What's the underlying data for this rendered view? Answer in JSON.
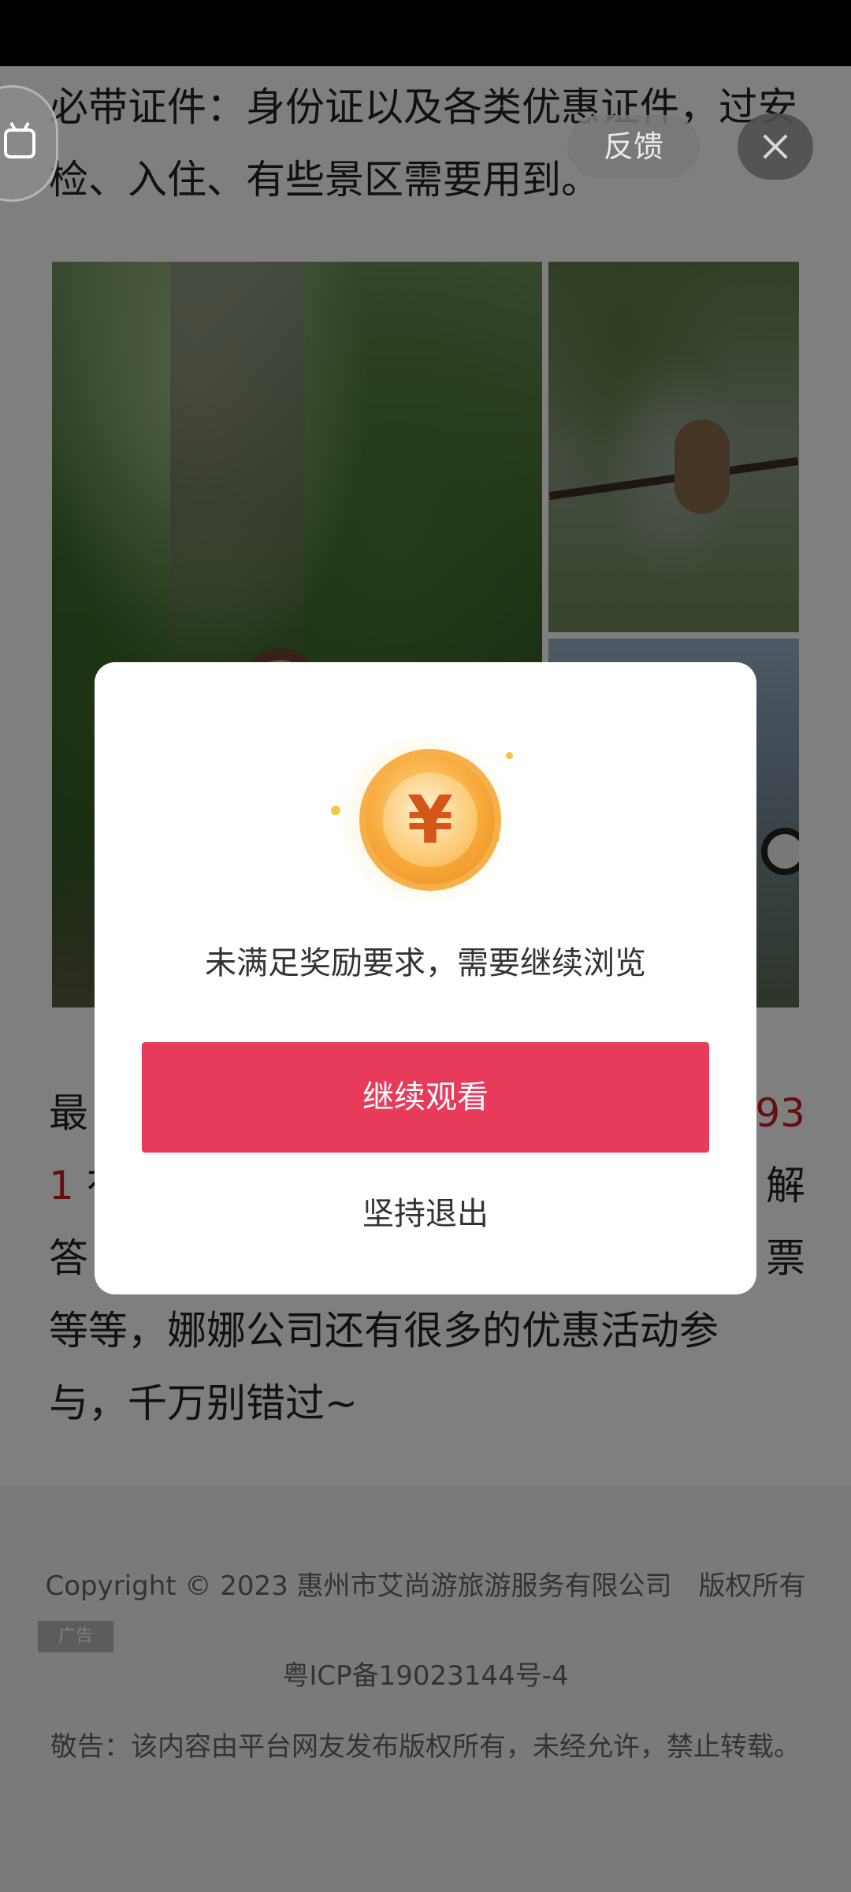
{
  "article": {
    "paragraph_top": "必带证件：身份证以及各类优惠证件，过安检、入住、有些景区需要用到。",
    "paragraph_bottom": {
      "line1_start": "最",
      "line1_red": "93",
      "line2_red": "1",
      "line2_start": "有",
      "line2_end": "解",
      "line3_start": "答",
      "line3_end": "票",
      "line4": "等等，娜娜公司还有很多的优惠活动参",
      "line5": "与，千万别错过~"
    }
  },
  "footer": {
    "copyright": "Copyright © 2023 惠州市艾尚游旅游服务有限公司　版权所有",
    "icp": "粤ICP备19023144号-4",
    "notice": "敬告：该内容由平台网友发布版权所有，未经允许，禁止转载。",
    "ad_badge": "广告"
  },
  "overlay_controls": {
    "feedback_label": "反馈"
  },
  "dialog": {
    "coin_symbol": "¥",
    "message": "未满足奖励要求，需要继续浏览",
    "continue_label": "继续观看",
    "exit_label": "坚持退出"
  },
  "colors": {
    "accent": "#e83a5a",
    "overlay": "rgba(0,0,0,0.5)",
    "link_red": "#c81e1e"
  }
}
